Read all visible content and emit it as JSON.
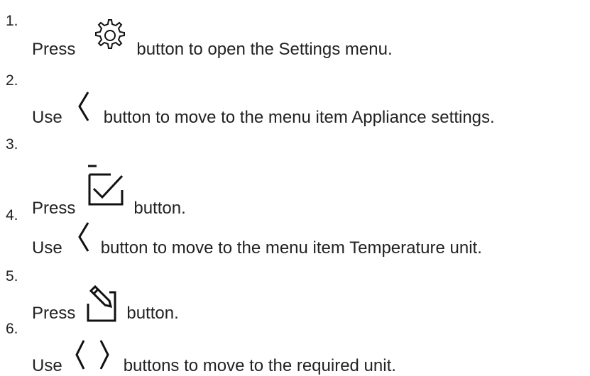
{
  "steps": [
    {
      "number": "1.",
      "pre": "Press",
      "icon": "gear-icon",
      "post": "button to open the Settings menu."
    },
    {
      "number": "2.",
      "pre": "Use",
      "icon": "chevron-left-icon",
      "post": "button to move to the menu item Appliance settings."
    },
    {
      "number": "3.",
      "pre": "Press",
      "icon": "checkbox-confirm-icon",
      "post": "button."
    },
    {
      "number": "4.",
      "pre": "Use",
      "icon": "chevron-left-icon",
      "post": "button to move to the menu item Temperature unit."
    },
    {
      "number": "5.",
      "pre": "Press",
      "icon": "edit-pencil-icon",
      "post": "button."
    },
    {
      "number": "6.",
      "pre": "Use",
      "icon": "chevron-left-right-icon",
      "post": "buttons to move to the required unit."
    }
  ]
}
